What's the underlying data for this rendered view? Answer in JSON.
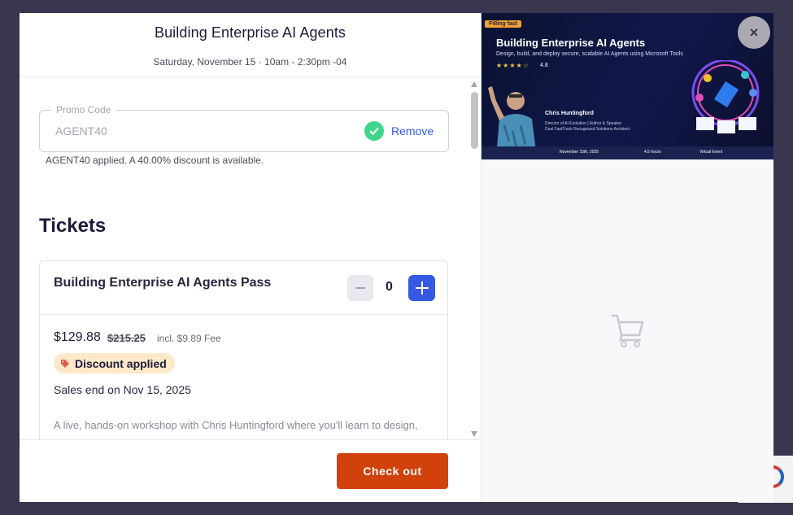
{
  "event": {
    "title": "Building Enterprise AI Agents",
    "date": "Saturday, November 15 · 10am - 2:30pm -04"
  },
  "promo": {
    "label": "Promo Code",
    "value": "AGENT40",
    "remove_label": "Remove",
    "message": "AGENT40 applied. A 40.00% discount is available."
  },
  "tickets": {
    "heading": "Tickets",
    "items": [
      {
        "name": "Building Enterprise AI Agents Pass",
        "quantity": "0",
        "price": "$129.88",
        "original_price": "$215.25",
        "fee": "incl. $9.89 Fee",
        "badge": "Discount applied",
        "sales_end": "Sales end on Nov 15, 2025",
        "description": "A live, hands-on workshop with Chris Huntingford where you'll learn to design, secure, and deploy real, low-code AI agents using Microsoft tools"
      }
    ]
  },
  "footer": {
    "checkout_label": "Check out"
  },
  "banner": {
    "badge": "Filling fast",
    "title": "Building Enterprise AI Agents",
    "subtitle": "Design, build, and deploy secure, scalable AI Agents using Microsoft Tools",
    "stars": "★★★★☆",
    "rating": "4.8",
    "speaker": "Chris Huntingford",
    "speaker_role_1": "Director of AI Evolution | Author & Speaker",
    "speaker_role_2": "Dual FastTrack Recognised Solutions Architect",
    "date": "November 15th, 2025",
    "duration": "4.5 hours",
    "format": "Virtual Event"
  },
  "close_label": "×",
  "colors": {
    "accent": "#3659e3",
    "checkout": "#d1410c",
    "success": "#3fd68c",
    "badge_bg": "#fde8c9"
  }
}
